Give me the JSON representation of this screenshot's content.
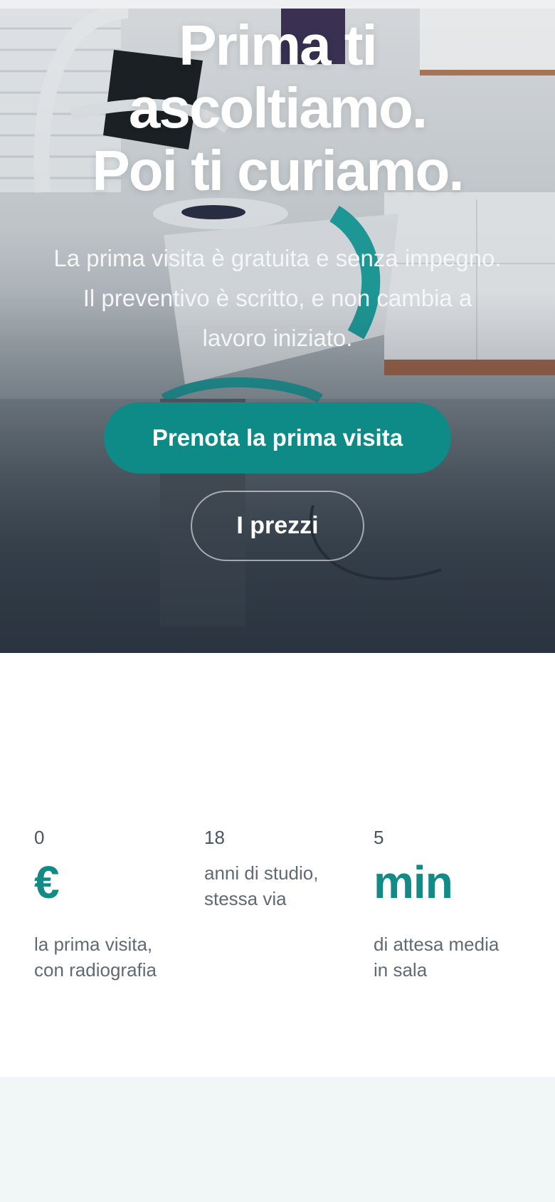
{
  "hero": {
    "title_line1": "Prima ti",
    "title_line2": "ascoltiamo.",
    "title_line3": "Poi ti curiamo.",
    "subtitle": "La prima visita è gratuita e senza impegno. Il preventivo è scritto, e non cambia a lavoro iniziato.",
    "primary_cta": "Prenota la prima visita",
    "secondary_cta": "I prezzi"
  },
  "stats": [
    {
      "number": "0",
      "unit": "€",
      "label_line1": "la prima visita,",
      "label_line2": "con radiografia"
    },
    {
      "number": "18",
      "unit": "",
      "label_line1": "anni di studio,",
      "label_line2": "stessa via"
    },
    {
      "number": "5",
      "unit": "min",
      "label_line1": "di attesa media",
      "label_line2": "in sala"
    }
  ],
  "colors": {
    "accent": "#0e8a87",
    "stat_accent": "#128a86",
    "text_muted": "#5f6a74",
    "bottom_band": "#f1f6f6"
  }
}
